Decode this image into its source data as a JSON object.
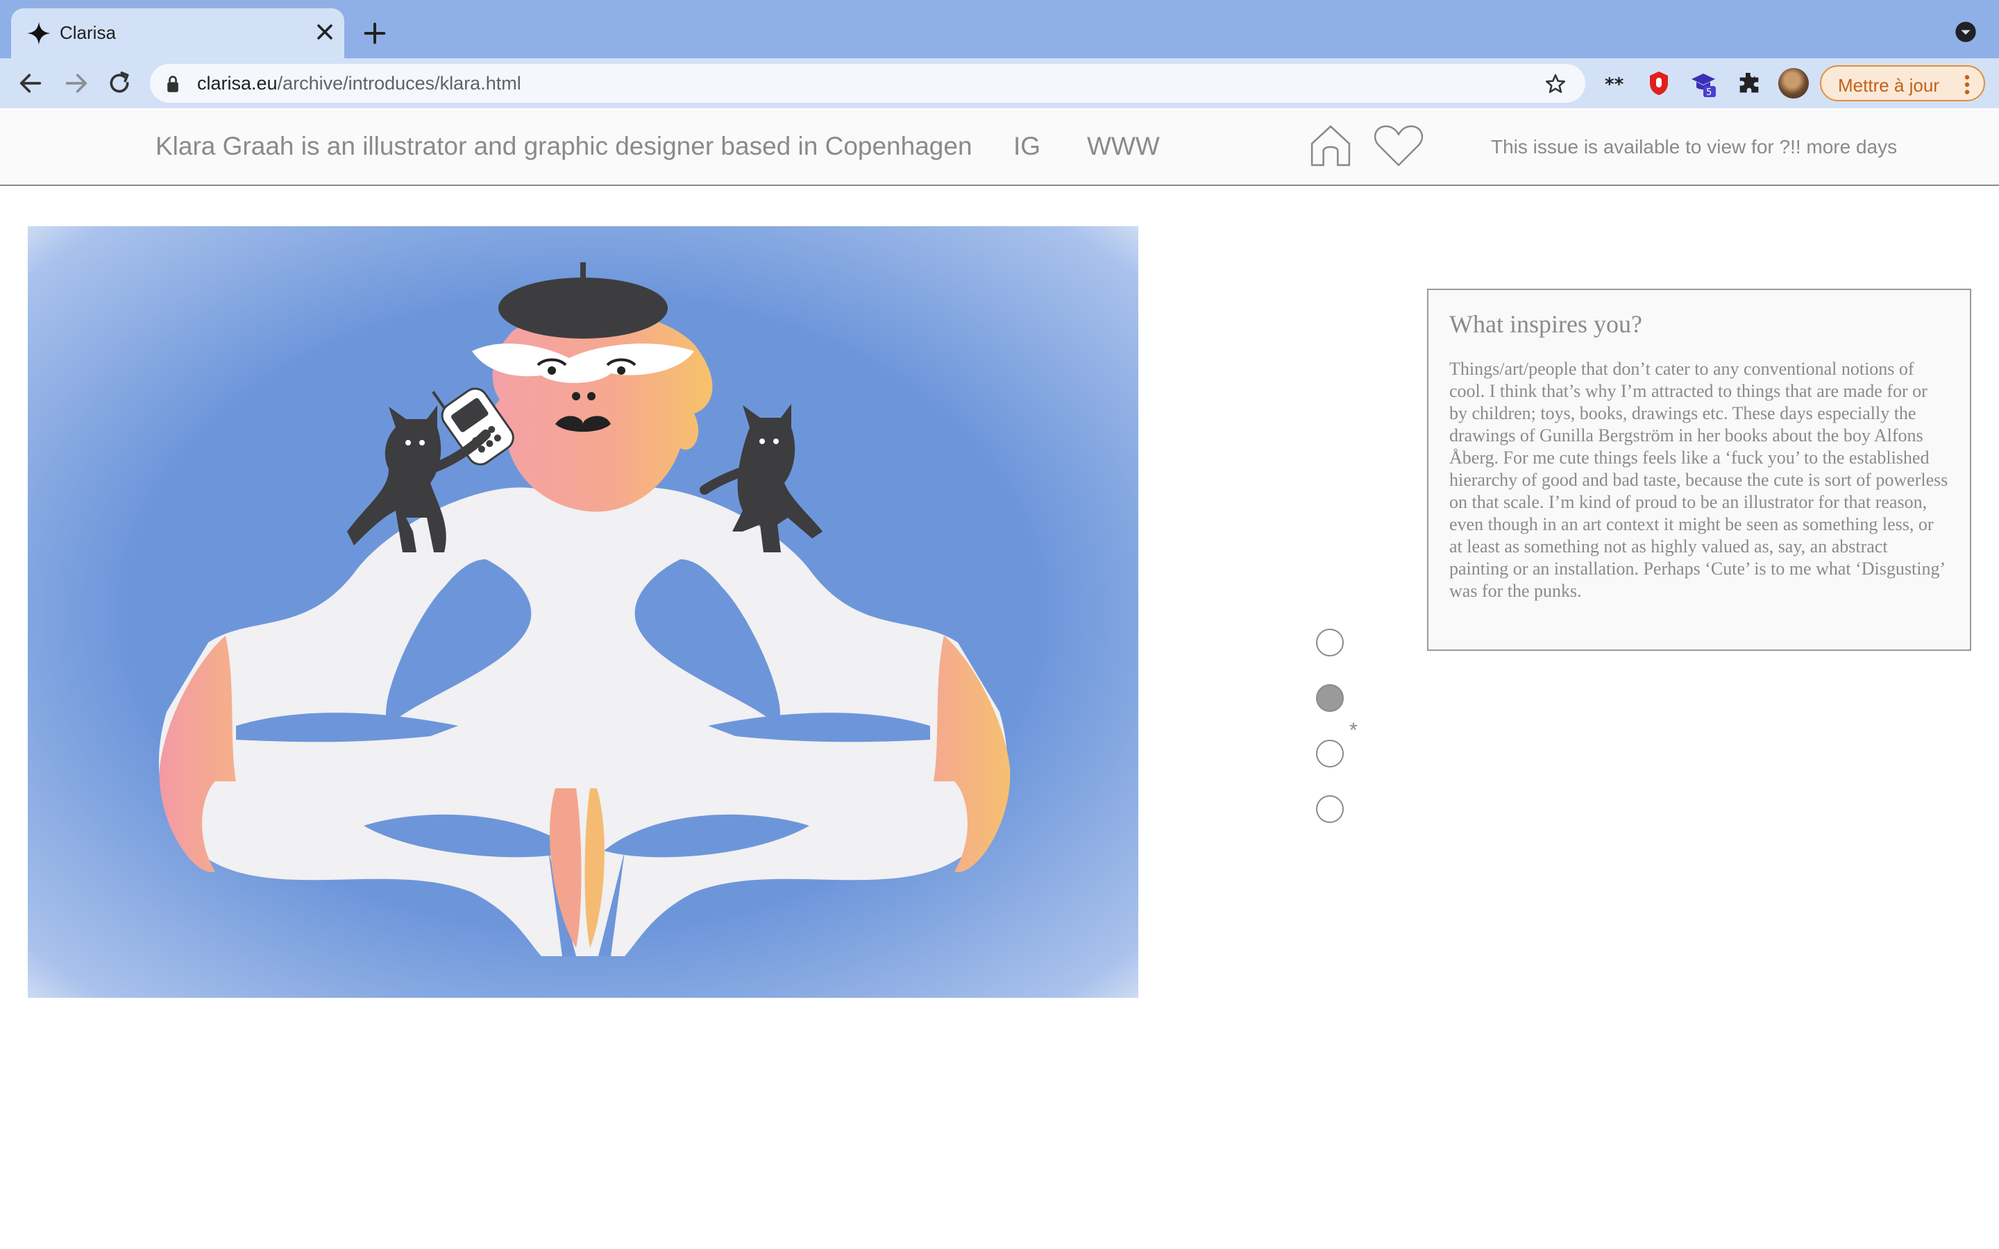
{
  "browser": {
    "tab_title": "Clarisa",
    "url_host": "clarisa.eu",
    "url_path": "/archive/introduces/klara.html",
    "update_label": "Mettre à jour",
    "extension_badge": "5"
  },
  "header": {
    "tagline": "Klara Graah is an illustrator and graphic designer based in Copenhagen",
    "link_ig": "IG",
    "link_www": "WWW",
    "availability": "This issue is available to view for ?!! more days"
  },
  "slides": {
    "count": 4,
    "active_index": 1,
    "marker": "*"
  },
  "qa": {
    "question": "What inspires you?",
    "answer": "Things/art/people that don’t cater to any conventional notions of cool. I think that’s why I’m attracted to things that are made for or by children; toys, books, drawings etc. These days especially the drawings of Gunilla Bergström in her books about the boy Alfons Åberg. For me cute things feels like a ‘fuck you’ to the established hierarchy of good and bad taste, because the cute is sort of powerless on that scale. I’m kind of proud to be an illustrator for that reason, even though in an art context it might be seen as something less, or at least as something not as highly valued as, say, an abstract painting or an installation. Perhaps ‘Cute’ is to me what ‘Disgusting’ was for the punks."
  },
  "colors": {
    "tabstrip": "#8fb0e6",
    "toolbar": "#d3e1f7",
    "page_text": "#8a8a8a",
    "art_blue": "#6d96da"
  }
}
